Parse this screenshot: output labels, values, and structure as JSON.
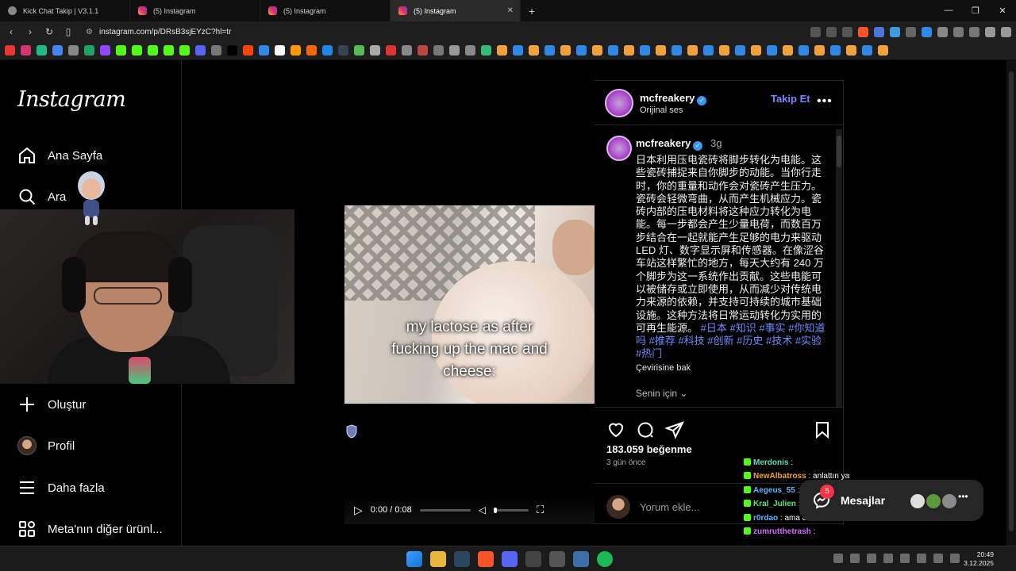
{
  "browser": {
    "tabs": [
      {
        "title": "Kick Chat Takip | V3.1.1",
        "active": false
      },
      {
        "title": "(5) Instagram",
        "active": false
      },
      {
        "title": "(5) Instagram",
        "active": false
      },
      {
        "title": "(5) Instagram",
        "active": true
      }
    ],
    "url": "instagram.com/p/DRsB3sjEYzC?hl=tr"
  },
  "sidebar": {
    "logo": "Instagram",
    "items": [
      {
        "label": "Ana Sayfa",
        "icon": "home-icon"
      },
      {
        "label": "Ara",
        "icon": "search-icon"
      },
      {
        "label": "Oluştur",
        "icon": "plus-icon"
      },
      {
        "label": "Profil",
        "icon": "profile-avatar"
      },
      {
        "label": "Daha fazla",
        "icon": "menu-icon"
      },
      {
        "label": "Meta'nın diğer ürünl...",
        "icon": "apps-icon"
      }
    ]
  },
  "video": {
    "caption_line1": "my lactose as after",
    "caption_line2": "fucking up the mac and",
    "caption_line3": "cheese:",
    "time": "0:00 / 0:08"
  },
  "post": {
    "header": {
      "username": "mcfreakery",
      "audio": "Orijinal ses",
      "follow": "Takip Et"
    },
    "caption": {
      "username": "mcfreakery",
      "age": "3g",
      "text": "日本利用压电瓷砖将脚步转化为电能。这些瓷砖捕捉来自你脚步的动能。当你行走时，你的重量和动作会对瓷砖产生压力。瓷砖会轻微弯曲，从而产生机械应力。瓷砖内部的压电材料将这种应力转化为电能。每一步都会产生少量电荷，而数百万步结合在一起就能产生足够的电力来驱动 LED 灯、数字显示屏和传感器。在像涩谷车站这样繁忙的地方，每天大约有 240 万个脚步为这一系统作出贡献。这些电能可以被储存或立即使用，从而减少对传统电力来源的依赖，并支持可持续的城市基础设施。这种方法将日常运动转化为实用的可再生能源。",
      "hashtags": "#日本 #知识 #事实 #你知道吗 #推荐 #科技 #创新 #历史 #技术 #实验 #热门",
      "translate": "Çevirisine bak",
      "for_you": "Senin için"
    },
    "likes": "183.059 beğenme",
    "posted": "3 gün önce",
    "comment_placeholder": "Yorum ekle..."
  },
  "chat_overlay": [
    {
      "user": "Merdonis",
      "msg": "",
      "color": "#5de0b6"
    },
    {
      "user": "NewAlbatross",
      "msg": "anlattın ya",
      "color": "#f0a233"
    },
    {
      "user": "Aegeus_55",
      "msg": "",
      "color": "#5fb4ff"
    },
    {
      "user": "Kral_Julien",
      "msg": "",
      "color": "#5de07a"
    },
    {
      "user": "r0rdao",
      "msg": "ama dona",
      "color": "#5fb4ff"
    },
    {
      "user": "zumrutthetrash",
      "msg": "",
      "color": "#d56bff"
    }
  ],
  "messages": {
    "label": "Mesajlar",
    "badge": "5"
  },
  "taskbar": {
    "time": "20:49",
    "date": "3.12.2025"
  }
}
